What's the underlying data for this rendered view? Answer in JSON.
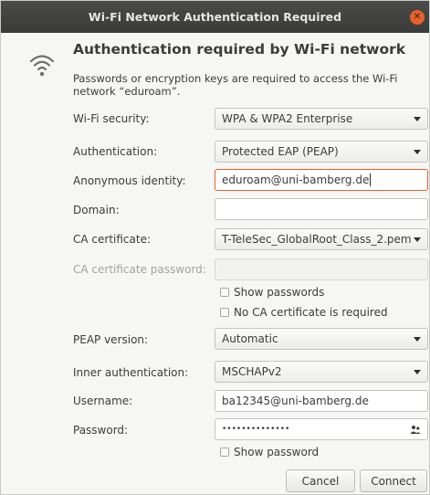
{
  "window": {
    "title": "Wi-Fi Network Authentication Required"
  },
  "icons": {
    "wifi": "wifi-icon",
    "close": "close-icon",
    "password_options": "person-icon"
  },
  "colors": {
    "accent": "#e8602c",
    "titlebar": "#3b3b39"
  },
  "heading": "Authentication required by Wi-Fi network",
  "message": "Passwords or encryption keys are required to access the Wi-Fi network “eduroam”.",
  "fields": {
    "wifi_security": {
      "label": "Wi-Fi security:",
      "value": "WPA & WPA2 Enterprise"
    },
    "authentication": {
      "label": "Authentication:",
      "value": "Protected EAP (PEAP)"
    },
    "anonymous_identity": {
      "label": "Anonymous identity:",
      "value": "eduroam@uni-bamberg.de"
    },
    "domain": {
      "label": "Domain:",
      "value": ""
    },
    "ca_certificate": {
      "label": "CA certificate:",
      "value": "T-TeleSec_GlobalRoot_Class_2.pem"
    },
    "ca_certificate_password": {
      "label": "CA certificate password:",
      "value": ""
    },
    "show_passwords": {
      "label": "Show passwords",
      "checked": false
    },
    "no_ca_required": {
      "label": "No CA certificate is required",
      "checked": false
    },
    "peap_version": {
      "label": "PEAP version:",
      "value": "Automatic"
    },
    "inner_authentication": {
      "label": "Inner authentication:",
      "value": "MSCHAPv2"
    },
    "username": {
      "label": "Username:",
      "value": "ba12345@uni-bamberg.de"
    },
    "password": {
      "label": "Password:",
      "value": "••••••••••••••"
    },
    "show_password": {
      "label": "Show password",
      "checked": false
    }
  },
  "buttons": {
    "cancel": "Cancel",
    "connect": "Connect"
  }
}
